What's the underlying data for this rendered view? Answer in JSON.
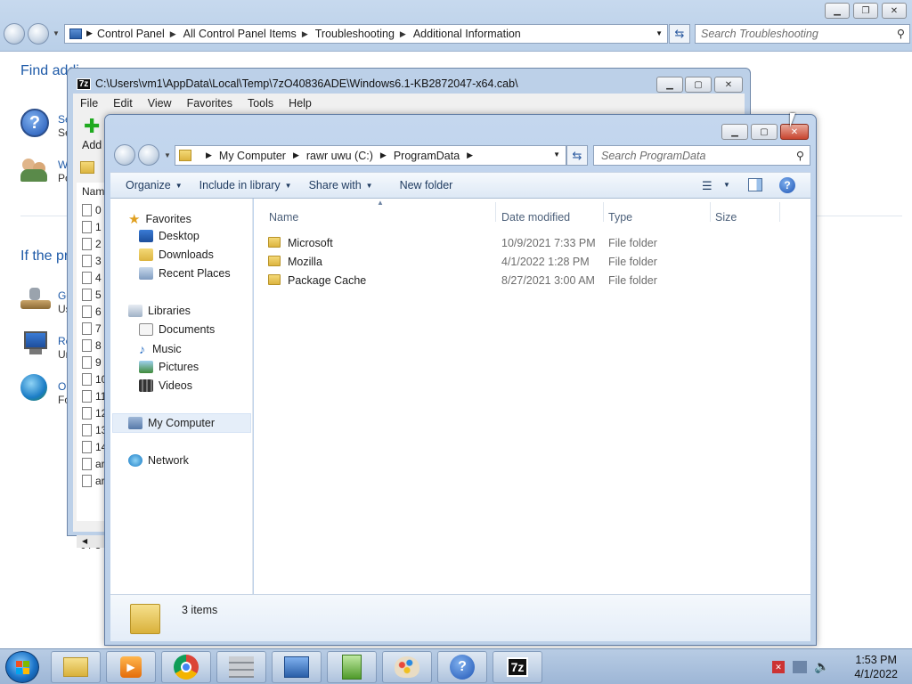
{
  "control_panel": {
    "breadcrumb": [
      "Control Panel",
      "All Control Panel Items",
      "Troubleshooting",
      "Additional Information"
    ],
    "search_placeholder": "Search Troubleshooting",
    "heading1": "Find additional information and ... support",
    "heading1_visible": "Find addi",
    "heading2_visible": "If the pr",
    "items": [
      {
        "link": "Se",
        "sub": "Se"
      },
      {
        "link": "W",
        "sub": "Po"
      },
      {
        "link": "Go",
        "sub": "Us"
      },
      {
        "link": "Re",
        "sub": "Ur"
      },
      {
        "link": "O",
        "sub": "Fo"
      }
    ]
  },
  "sevenzip": {
    "title": "C:\\Users\\vm1\\AppData\\Local\\Temp\\7zO40836ADE\\Windows6.1-KB2872047-x64.cab\\",
    "logo": "7z",
    "menu": [
      "File",
      "Edit",
      "View",
      "Favorites",
      "Tools",
      "Help"
    ],
    "add_label": "Add",
    "column_name": "Nam",
    "rows": [
      "0",
      "1",
      "2",
      "3",
      "4",
      "5",
      "6",
      "7",
      "8",
      "9",
      "10",
      "11",
      "12",
      "13",
      "14",
      "ar",
      "ar"
    ],
    "status": "0 / 34"
  },
  "explorer": {
    "breadcrumb": [
      "My Computer",
      "rawr uwu (C:)",
      "ProgramData"
    ],
    "search_placeholder": "Search ProgramData",
    "commands": [
      "Organize",
      "Include in library",
      "Share with",
      "New folder"
    ],
    "nav": {
      "favorites": "Favorites",
      "favorites_items": [
        "Desktop",
        "Downloads",
        "Recent Places"
      ],
      "libraries": "Libraries",
      "libraries_items": [
        "Documents",
        "Music",
        "Pictures",
        "Videos"
      ],
      "computer": "My Computer",
      "network": "Network"
    },
    "columns": [
      "Name",
      "Date modified",
      "Type",
      "Size"
    ],
    "files": [
      {
        "name": "Microsoft",
        "date": "10/9/2021 7:33 PM",
        "type": "File folder"
      },
      {
        "name": "Mozilla",
        "date": "4/1/2022 1:28 PM",
        "type": "File folder"
      },
      {
        "name": "Package Cache",
        "date": "8/27/2021 3:00 AM",
        "type": "File folder"
      }
    ],
    "status": "3 items"
  },
  "taskbar": {
    "time": "1:53 PM",
    "date": "4/1/2022",
    "zip_logo": "7z"
  }
}
